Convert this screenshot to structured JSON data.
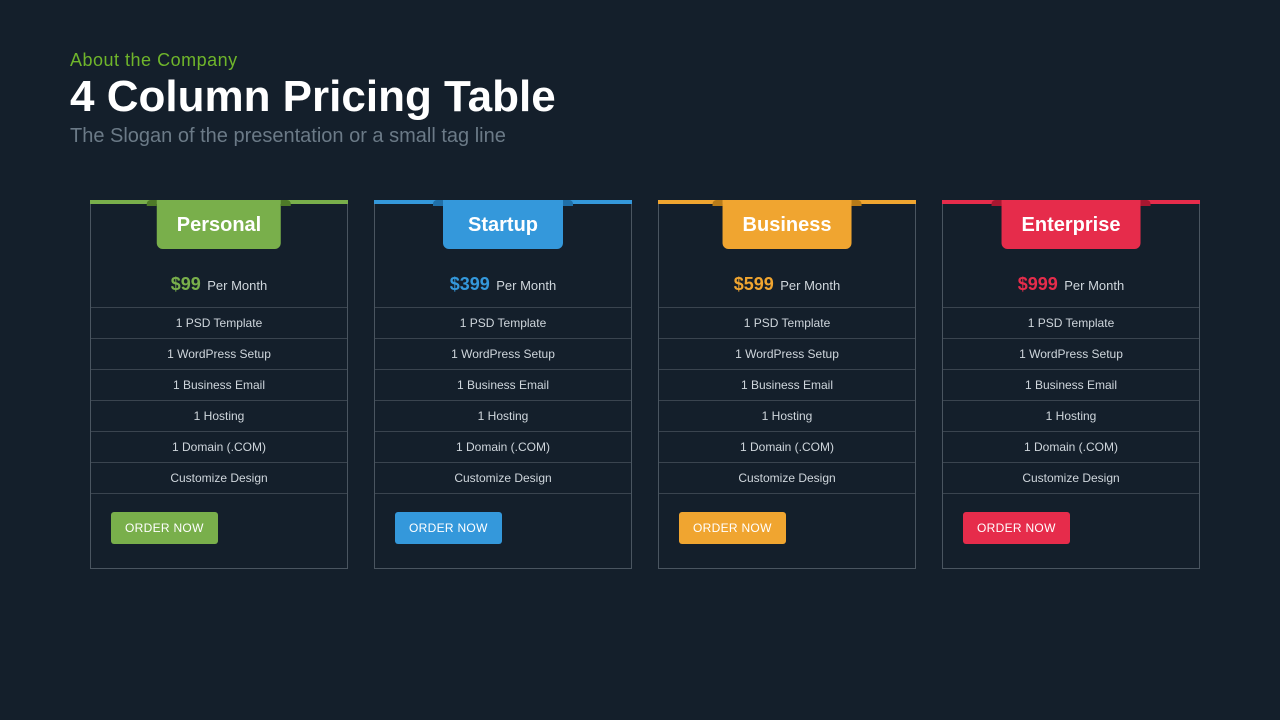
{
  "header": {
    "eyebrow": "About the Company",
    "title": "4 Column Pricing Table",
    "tagline": "The Slogan of the presentation or a small tag line"
  },
  "per_label": "Per Month",
  "cta_label": "ORDER NOW",
  "features": [
    "1 PSD Template",
    "1 WordPress Setup",
    "1 Business Email",
    "1 Hosting",
    "1 Domain (.COM)",
    "Customize Design"
  ],
  "plans": [
    {
      "name": "Personal",
      "price": "$99",
      "accent": "#79af4b",
      "accent_dark": "#4e7a28"
    },
    {
      "name": "Startup",
      "price": "$399",
      "accent": "#3498db",
      "accent_dark": "#1f6fa8"
    },
    {
      "name": "Business",
      "price": "$599",
      "accent": "#f0a530",
      "accent_dark": "#b87b18"
    },
    {
      "name": "Enterprise",
      "price": "$999",
      "accent": "#e62c4b",
      "accent_dark": "#a71730"
    }
  ]
}
